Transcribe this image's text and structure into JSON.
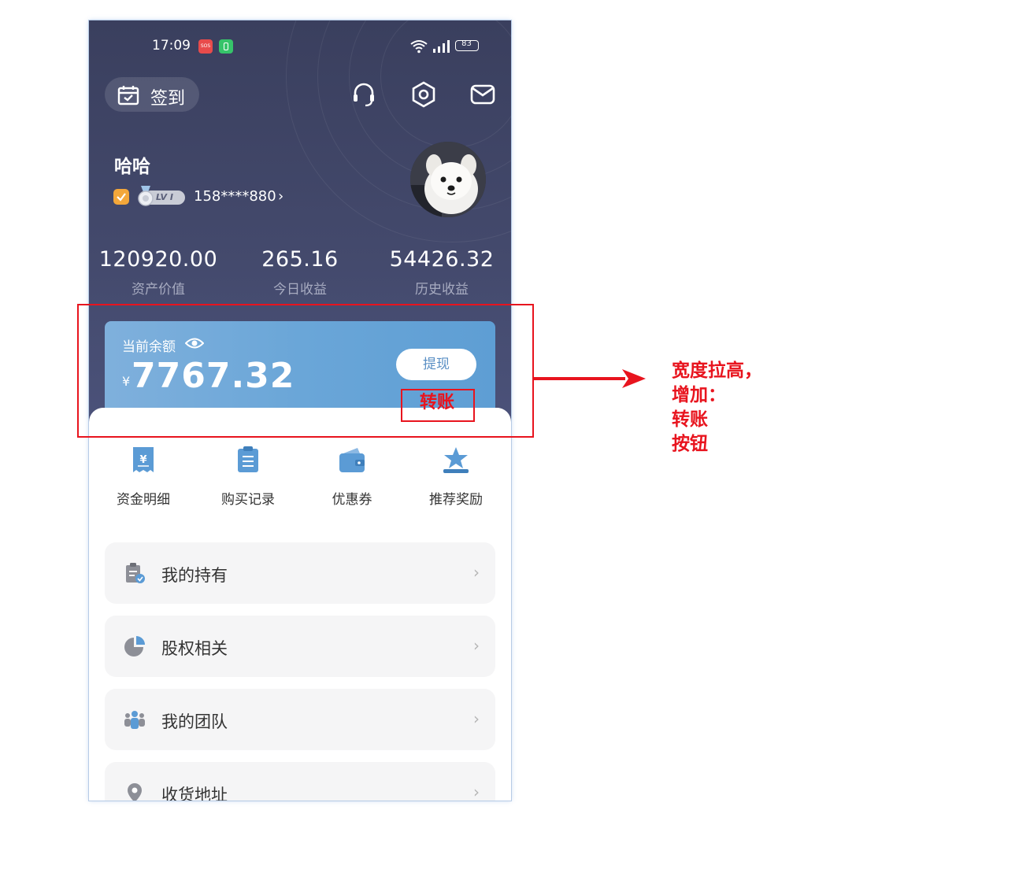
{
  "status_bar": {
    "time": "17:09",
    "sos_label": "SOS",
    "battery": "83"
  },
  "header": {
    "checkin_label": "签到"
  },
  "user": {
    "name": "哈哈",
    "level": "LV I",
    "phone": "158****880"
  },
  "stats": [
    {
      "value": "120920.00",
      "label": "资产价值"
    },
    {
      "value": "265.16",
      "label": "今日收益"
    },
    {
      "value": "54426.32",
      "label": "历史收益"
    }
  ],
  "balance": {
    "title": "当前余额",
    "currency": "¥",
    "amount": "7767.32",
    "withdraw_label": "提现",
    "transfer_label": "转账"
  },
  "quick_links": [
    {
      "label": "资金明细",
      "icon": "receipt-yen-icon"
    },
    {
      "label": "购买记录",
      "icon": "clipboard-icon"
    },
    {
      "label": "优惠券",
      "icon": "wallet-icon"
    },
    {
      "label": "推荐奖励",
      "icon": "star-award-icon"
    }
  ],
  "menu": [
    {
      "label": "我的持有",
      "icon": "holdings-icon"
    },
    {
      "label": "股权相关",
      "icon": "pie-chart-icon"
    },
    {
      "label": "我的团队",
      "icon": "team-icon"
    },
    {
      "label": "收货地址",
      "icon": "location-pin-icon"
    }
  ],
  "annotation": {
    "line1": "宽度拉高，",
    "line2": "增加：",
    "line3": "转账",
    "line4": "按钮"
  },
  "colors": {
    "hero_bg": "#3d4264",
    "card_blue": "#6aa6d8",
    "annotation_red": "#e8141e",
    "icon_blue": "#5b9bd5"
  }
}
